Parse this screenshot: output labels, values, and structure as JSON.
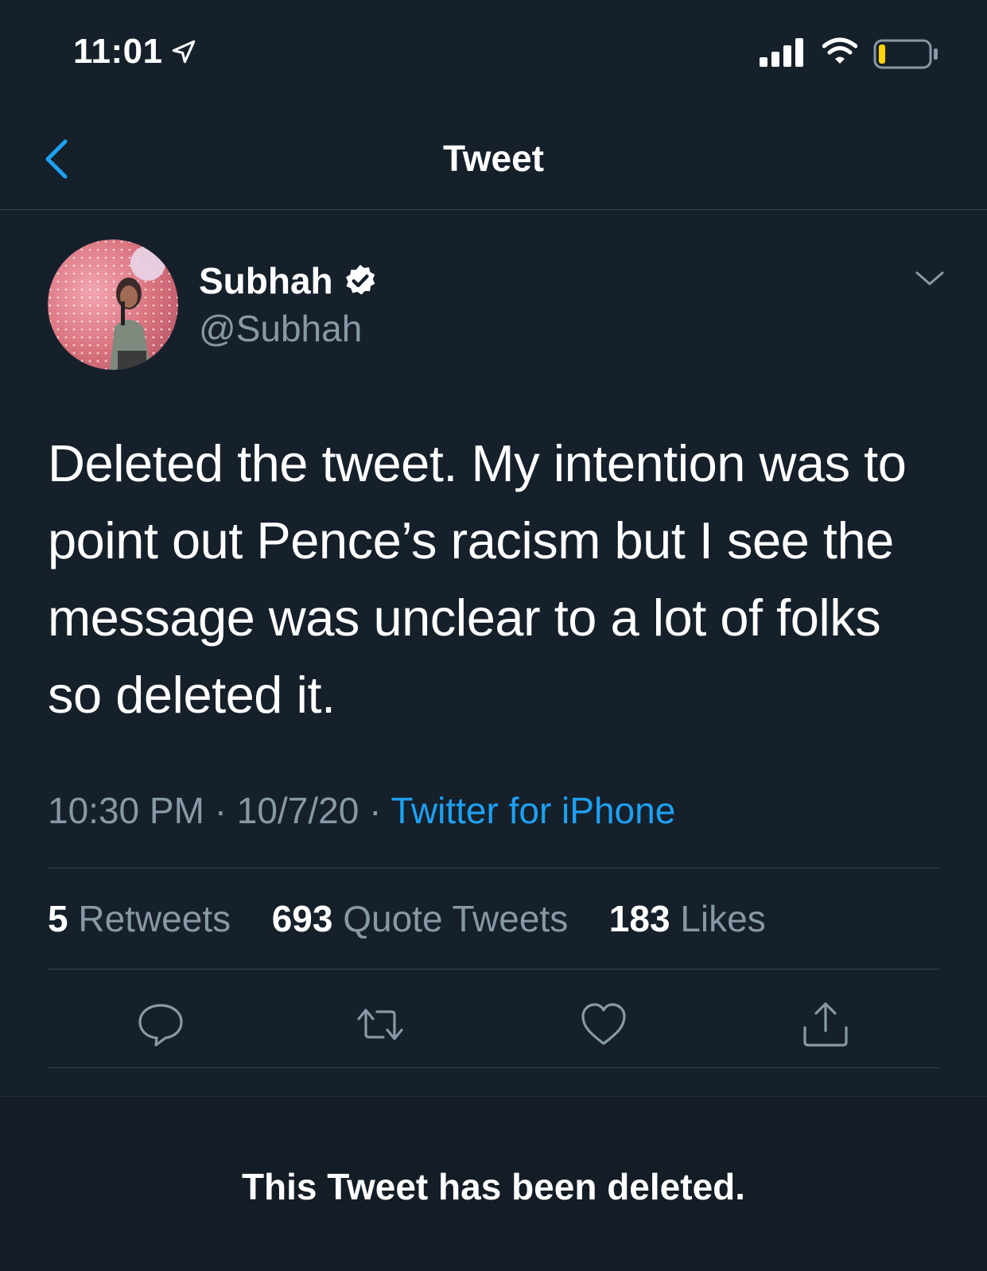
{
  "status_bar": {
    "time": "11:01",
    "icons": [
      "location-arrow-icon",
      "cellular-signal-icon",
      "wifi-icon",
      "battery-icon"
    ]
  },
  "nav": {
    "title": "Tweet",
    "back_icon": "chevron-left-icon"
  },
  "author": {
    "name": "Subhah",
    "handle": "@Subhah",
    "verified": true,
    "avatar": "profile photo"
  },
  "tweet": {
    "text": "Deleted the tweet. My intention was to point out Pence’s racism but I see the message was unclear to a lot of folks so deleted it.",
    "time": "10:30 PM",
    "date": "10/7/20",
    "separator": "·",
    "source": "Twitter for iPhone"
  },
  "stats": {
    "retweets_count": "5",
    "retweets_label": "Retweets",
    "quote_count": "693",
    "quote_label": "Quote Tweets",
    "likes_count": "183",
    "likes_label": "Likes"
  },
  "actions": [
    "reply-icon",
    "retweet-icon",
    "like-icon",
    "share-icon"
  ],
  "banner": {
    "text": "This Tweet has been deleted."
  },
  "colors": {
    "background": "#15202b",
    "accent": "#1da1f2",
    "secondary_text": "#8899a6",
    "divider": "#38444d",
    "battery_level": "#ffd400"
  }
}
